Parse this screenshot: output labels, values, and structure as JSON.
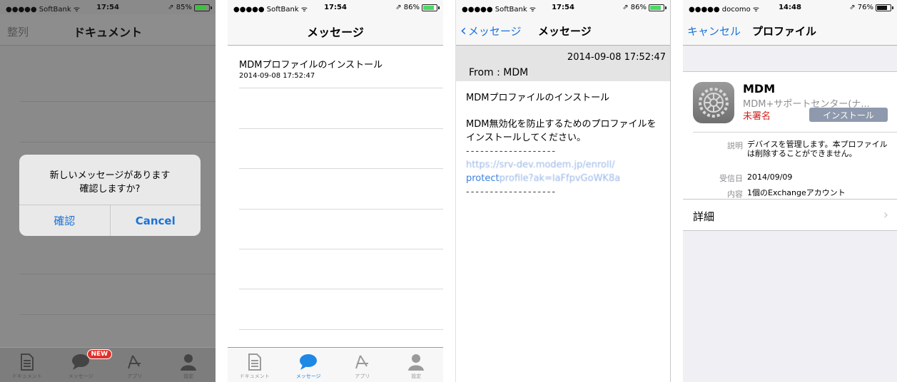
{
  "screens": [
    {
      "status": {
        "carrier": "●●●●● SoftBank ᯤ",
        "time": "17:54",
        "battery": "⇗ 85%",
        "battery_fill": 0.85
      },
      "nav": {
        "left": "整列",
        "title": "ドキュメント"
      },
      "alert": {
        "line1": "新しいメッセージがあります",
        "line2": "確認しますか?",
        "confirm": "確認",
        "cancel": "Cancel"
      },
      "tabs": [
        {
          "label": "ドキュメント"
        },
        {
          "label": "メッセージ",
          "badge": "NEW"
        },
        {
          "label": "アプリ"
        },
        {
          "label": "設定"
        }
      ]
    },
    {
      "status": {
        "carrier": "●●●●● SoftBank ᯤ",
        "time": "17:54",
        "battery": "⇗ 86%",
        "battery_fill": 0.86
      },
      "nav": {
        "title": "メッセージ"
      },
      "message": {
        "title": "MDMプロファイルのインストール",
        "date": "2014-09-08 17:52:47"
      },
      "tabs": [
        {
          "label": "ドキュメント"
        },
        {
          "label": "メッセージ"
        },
        {
          "label": "アプリ"
        },
        {
          "label": "設定"
        }
      ]
    },
    {
      "status": {
        "carrier": "●●●●● SoftBank ᯤ",
        "time": "17:54",
        "battery": "⇗ 86%",
        "battery_fill": 0.86
      },
      "nav": {
        "back": "メッセージ",
        "title": "メッセージ"
      },
      "header": {
        "date": "2014-09-08 17:52:47",
        "from": "From : MDM"
      },
      "body": {
        "subject": "MDMプロファイルのインストール",
        "text": "MDM無効化を防止するためのプロファイルをインストールしてください。",
        "dashes": "-------------------",
        "link_line1": "https://srv-dev.modem.jp/enroll/",
        "link_line2_a": "protect",
        "link_line2_b": "profile?ak=laFfpvGoWK8a",
        "dashes2": "-------------------"
      }
    },
    {
      "status": {
        "carrier": "●●●●● docomo ᯤ",
        "time": "14:48",
        "battery": "⇗ 76%",
        "battery_fill": 0.76
      },
      "nav": {
        "cancel": "キャンセル",
        "title": "プロファイル"
      },
      "profile": {
        "name": "MDM",
        "org": "MDM+サポートセンター(ナ...",
        "unsigned": "未署名",
        "install": "インストール",
        "details": [
          {
            "key": "説明",
            "value": "デバイスを管理します。本プロファイルは削除することができません。"
          },
          {
            "key": "受信日",
            "value": "2014/09/09"
          },
          {
            "key": "内容",
            "value": "1個のExchangeアカウント"
          }
        ],
        "more": "詳細"
      }
    }
  ]
}
